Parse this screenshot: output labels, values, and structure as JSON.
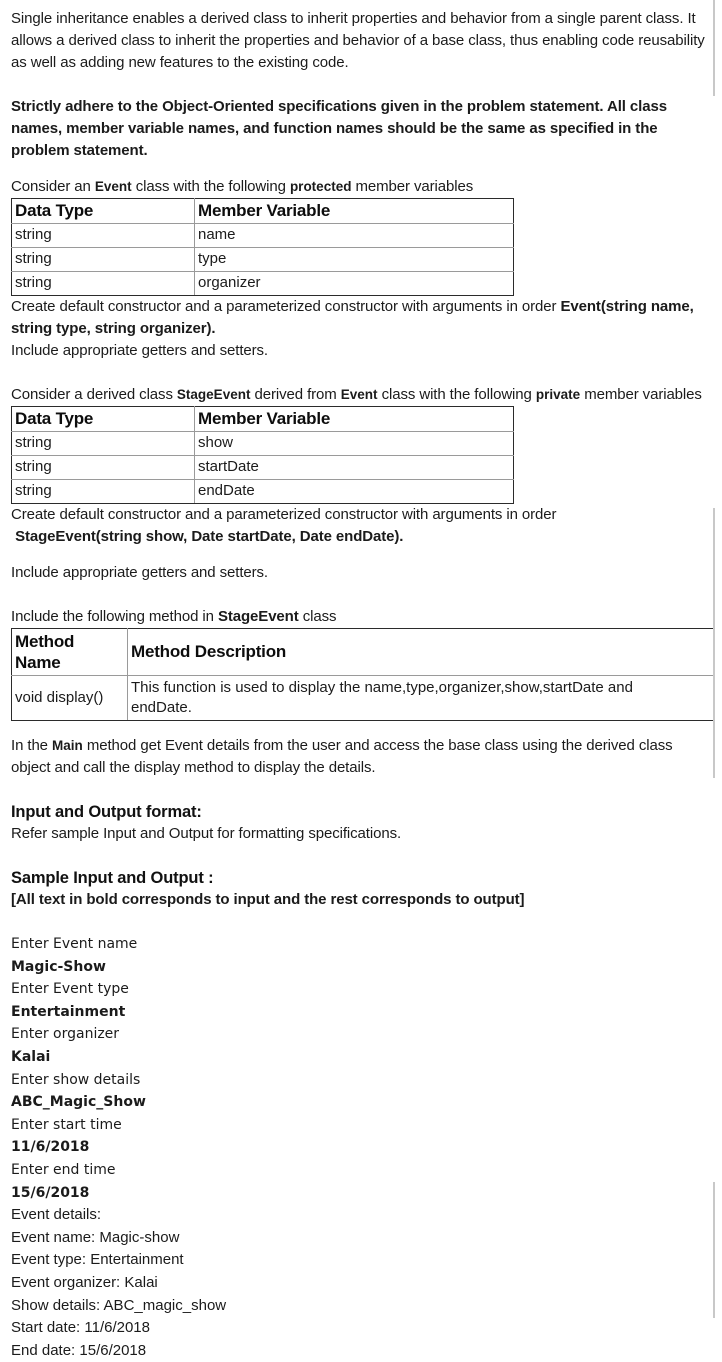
{
  "intro": {
    "paragraph_1": "Single inheritance enables a derived class to inherit properties and behavior from a single parent class. It allows a derived class to inherit the properties and behavior of a base class, thus enabling code reusability as well as adding new features to the existing code.",
    "paragraph_2": "Strictly adhere to the Object-Oriented specifications given in the problem statement. All class names, member variable names, and function names should be the same as specified in the problem statement."
  },
  "base_class": {
    "intro_before": "Consider an ",
    "class_name": "Event",
    "intro_middle": " class with the following ",
    "access_modifier": "protected",
    "intro_after": " member variables",
    "table": {
      "headers": [
        "Data Type",
        "Member Variable"
      ],
      "rows": [
        [
          "string",
          "name"
        ],
        [
          "string",
          "type"
        ],
        [
          "string",
          "organizer"
        ]
      ]
    },
    "constructor_text": "Create default constructor and a parameterized constructor with arguments in order ",
    "constructor_signature": "Event(string name, string type, string organizer).",
    "getters_setters": "Include appropriate getters and setters."
  },
  "derived_class": {
    "intro_before": "Consider a derived class ",
    "class_name": "StageEvent",
    "intro_middle": " derived from ",
    "base_name": "Event",
    "intro_middle_2": " class with the following ",
    "access_modifier": "private",
    "intro_after": " member variables",
    "table": {
      "headers": [
        "Data Type",
        "Member Variable"
      ],
      "rows": [
        [
          "string",
          "show"
        ],
        [
          "string",
          "startDate"
        ],
        [
          "string",
          "endDate"
        ]
      ]
    },
    "constructor_text": "Create default constructor and a parameterized constructor with arguments in order",
    "constructor_signature": "StageEvent(string show, Date startDate, Date endDate).",
    "getters_setters": "Include appropriate getters and setters."
  },
  "method_section": {
    "intro_before": "Include the following method in ",
    "class_name": "StageEvent",
    "intro_after": " class",
    "table": {
      "headers": [
        "Method Name",
        "Method Description"
      ],
      "header_name_line_1": "Method",
      "header_name_line_2": "Name",
      "rows": [
        {
          "name": "void display()",
          "description_line_1": "This function is used to display the name,type,organizer,show,startDate and",
          "description_line_2": "endDate."
        }
      ]
    }
  },
  "main_method": {
    "text_before": "In the ",
    "keyword": "Main",
    "text_after": " method get Event details from the user and access the base class using the derived class object and call the display method to display the details."
  },
  "io_format": {
    "heading": "Input and Output format:",
    "body": "Refer sample Input and Output for formatting specifications."
  },
  "sample": {
    "heading": "Sample Input and Output :",
    "note": "[All text in bold corresponds to input and the rest corresponds to output]",
    "lines": [
      {
        "text": "Enter Event name",
        "kind": "output"
      },
      {
        "text": "Magic-Show",
        "kind": "input"
      },
      {
        "text": "Enter Event type",
        "kind": "output"
      },
      {
        "text": "Entertainment",
        "kind": "input"
      },
      {
        "text": "Enter organizer",
        "kind": "output"
      },
      {
        "text": "Kalai",
        "kind": "input"
      },
      {
        "text": "Enter show details",
        "kind": "output"
      },
      {
        "text": "ABC_Magic_Show",
        "kind": "input"
      },
      {
        "text": "Enter start time",
        "kind": "output"
      },
      {
        "text": "11/6/2018",
        "kind": "input"
      },
      {
        "text": "Enter end time",
        "kind": "output"
      },
      {
        "text": "15/6/2018",
        "kind": "input"
      },
      {
        "text": "Event details:",
        "kind": "output2"
      },
      {
        "text": "Event name: Magic-show",
        "kind": "output2"
      },
      {
        "text": "Event type: Entertainment",
        "kind": "output2"
      },
      {
        "text": "Event organizer: Kalai",
        "kind": "output2"
      },
      {
        "text": "Show details: ABC_magic_show",
        "kind": "output2"
      },
      {
        "text": "Start date: 11/6/2018",
        "kind": "output2"
      },
      {
        "text": "End date: 15/6/2018",
        "kind": "output2"
      }
    ]
  },
  "colors": {
    "text": "#1b1b1b",
    "table_border_outer": "#2b2b2b",
    "table_border_inner": "#9a9a9a",
    "scrollbar": "#c8c8c8",
    "background": "#ffffff"
  }
}
